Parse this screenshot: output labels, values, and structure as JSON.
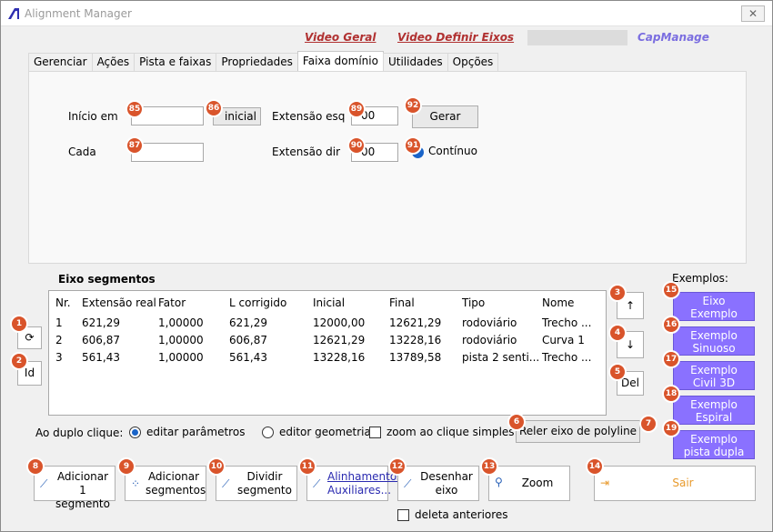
{
  "window": {
    "title": "Alignment Manager",
    "close_glyph": "✕",
    "icon_color": "#2f2fb0"
  },
  "top_links": {
    "video_geral": "Video Geral",
    "video_definir": "Video Definir Eixos",
    "capmanage": "CapManage"
  },
  "tabs": [
    "Gerenciar",
    "Ações",
    "Pista e faixas",
    "Propriedades",
    "Faixa domínio",
    "Utilidades",
    "Opções"
  ],
  "active_tab": "Faixa domínio",
  "faixa": {
    "inicio_label": "Início em",
    "inicio_value": "",
    "inicial_btn": "inicial",
    "cada_label": "Cada",
    "cada_value": "",
    "ext_esq_label": "Extensão esq",
    "ext_esq_value": "00",
    "ext_dir_label": "Extensão dir",
    "ext_dir_value": "00",
    "gerar_btn": "Gerar",
    "continuo_label": "Contínuo"
  },
  "segments": {
    "title": "Eixo segmentos",
    "columns": [
      "Nr.",
      "Extensão real",
      "Fator",
      "L corrigido",
      "Inicial",
      "Final",
      "Tipo",
      "Nome"
    ],
    "rows": [
      [
        "1",
        "621,29",
        "1,00000",
        "621,29",
        "12000,00",
        "12621,29",
        "rodoviário",
        "Trecho ..."
      ],
      [
        "2",
        "606,87",
        "1,00000",
        "606,87",
        "12621,29",
        "13228,16",
        "rodoviário",
        "Curva 1"
      ],
      [
        "3",
        "561,43",
        "1,00000",
        "561,43",
        "13228,16",
        "13789,58",
        "pista 2 senti...",
        "Trecho ..."
      ]
    ]
  },
  "side": {
    "refresh_glyph": "⟳",
    "id_label": "Id",
    "up_glyph": "↑",
    "down_glyph": "↓",
    "del_label": "Del"
  },
  "examples": {
    "title": "Exemplos:",
    "items": [
      {
        "l1": "Eixo",
        "l2": "Exemplo"
      },
      {
        "l1": "Exemplo",
        "l2": "Sinuoso"
      },
      {
        "l1": "Exemplo",
        "l2": "Civil 3D"
      },
      {
        "l1": "Exemplo",
        "l2": "Espiral"
      },
      {
        "l1": "Exemplo",
        "l2": "pista dupla"
      }
    ]
  },
  "dblclick": {
    "label": "Ao duplo clique:",
    "opt1": "editar parâmetros",
    "opt2": "editor geometria",
    "zoom_label": "zoom ao clique simples"
  },
  "reler_btn": "Reler eixo de polyline",
  "bottom": {
    "add1": {
      "l1": "Adicionar 1",
      "l2": "segmento"
    },
    "addn": {
      "l1": "Adicionar",
      "l2": "segmentos"
    },
    "dividir": {
      "l1": "Dividir",
      "l2": "segmento"
    },
    "alin": {
      "l1": "Alinhamentos",
      "l2": "Auxiliares..."
    },
    "desenhar": {
      "l1": "Desenhar",
      "l2": "eixo"
    },
    "zoom": "Zoom",
    "sair": "Sair",
    "deleta": "deleta anteriores"
  },
  "badges": [
    "1",
    "2",
    "3",
    "4",
    "5",
    "6",
    "7",
    "8",
    "9",
    "10",
    "11",
    "12",
    "13",
    "14",
    "15",
    "16",
    "17",
    "18",
    "19",
    "85",
    "86",
    "87",
    "89",
    "90",
    "91",
    "92"
  ],
  "colors": {
    "badge": "#d9542b",
    "example_btn": "#8a71ff",
    "link": "#b03030",
    "capmanage": "#7b6ee0",
    "sair_text": "#e89a2c"
  }
}
